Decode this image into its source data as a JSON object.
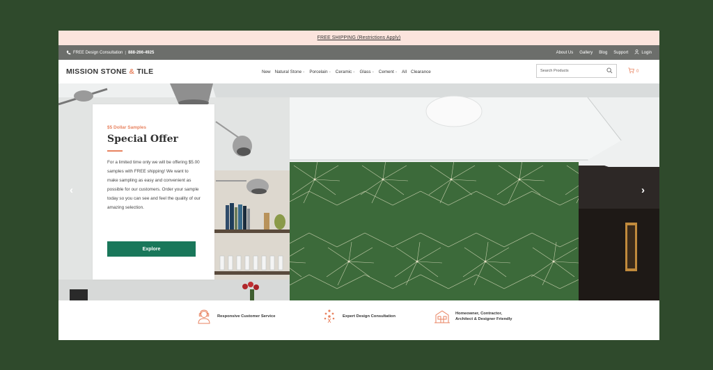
{
  "promo": {
    "text": "FREE SHIPPING (Restrictions Apply)"
  },
  "utility": {
    "consultation": "FREE Design Consultation",
    "separator": "|",
    "phone": "888-266-4925",
    "links": [
      "About Us",
      "Gallery",
      "Blog",
      "Support"
    ],
    "login": "Login"
  },
  "header": {
    "logo_left": "MISSION STONE",
    "logo_amp": "&",
    "logo_right": "TILE",
    "nav": [
      {
        "label": "New",
        "dropdown": false
      },
      {
        "label": "Natural Stone",
        "dropdown": true
      },
      {
        "label": "Porcelain",
        "dropdown": true
      },
      {
        "label": "Ceramic",
        "dropdown": true
      },
      {
        "label": "Glass",
        "dropdown": true
      },
      {
        "label": "Cement",
        "dropdown": true
      },
      {
        "label": "All",
        "dropdown": false
      },
      {
        "label": "Clearance",
        "dropdown": false
      }
    ],
    "search_placeholder": "Search Products",
    "cart_count": "0"
  },
  "hero": {
    "eyebrow": "$5 Dollar Samples",
    "title": "Special Offer",
    "body": "For a limited time only we will be offering $5.00 samples with FREE shipping!  We want to make sampling as easy and convenient as possible for our customers. Order your sample today so you can see and feel the quality of our amazing selection.",
    "button": "Explore",
    "prev_glyph": "‹",
    "next_glyph": "›"
  },
  "features": [
    {
      "icon": "customer-service-icon",
      "label_line1": "Responsive Customer Service",
      "label_line2": ""
    },
    {
      "icon": "design-consultation-icon",
      "label_line1": "Expert Design Consultation",
      "label_line2": ""
    },
    {
      "icon": "building-icon",
      "label_line1": "Homeowner, Contractor,",
      "label_line2": "Architect & Designer Friendly"
    }
  ],
  "colors": {
    "page_bg": "#2f4a2c",
    "accent": "#e8825f",
    "button": "#19775a",
    "promo_bg": "#fbe4dd",
    "utility_bg": "#6c6e6b",
    "tile_green": "#3c6a3a"
  }
}
